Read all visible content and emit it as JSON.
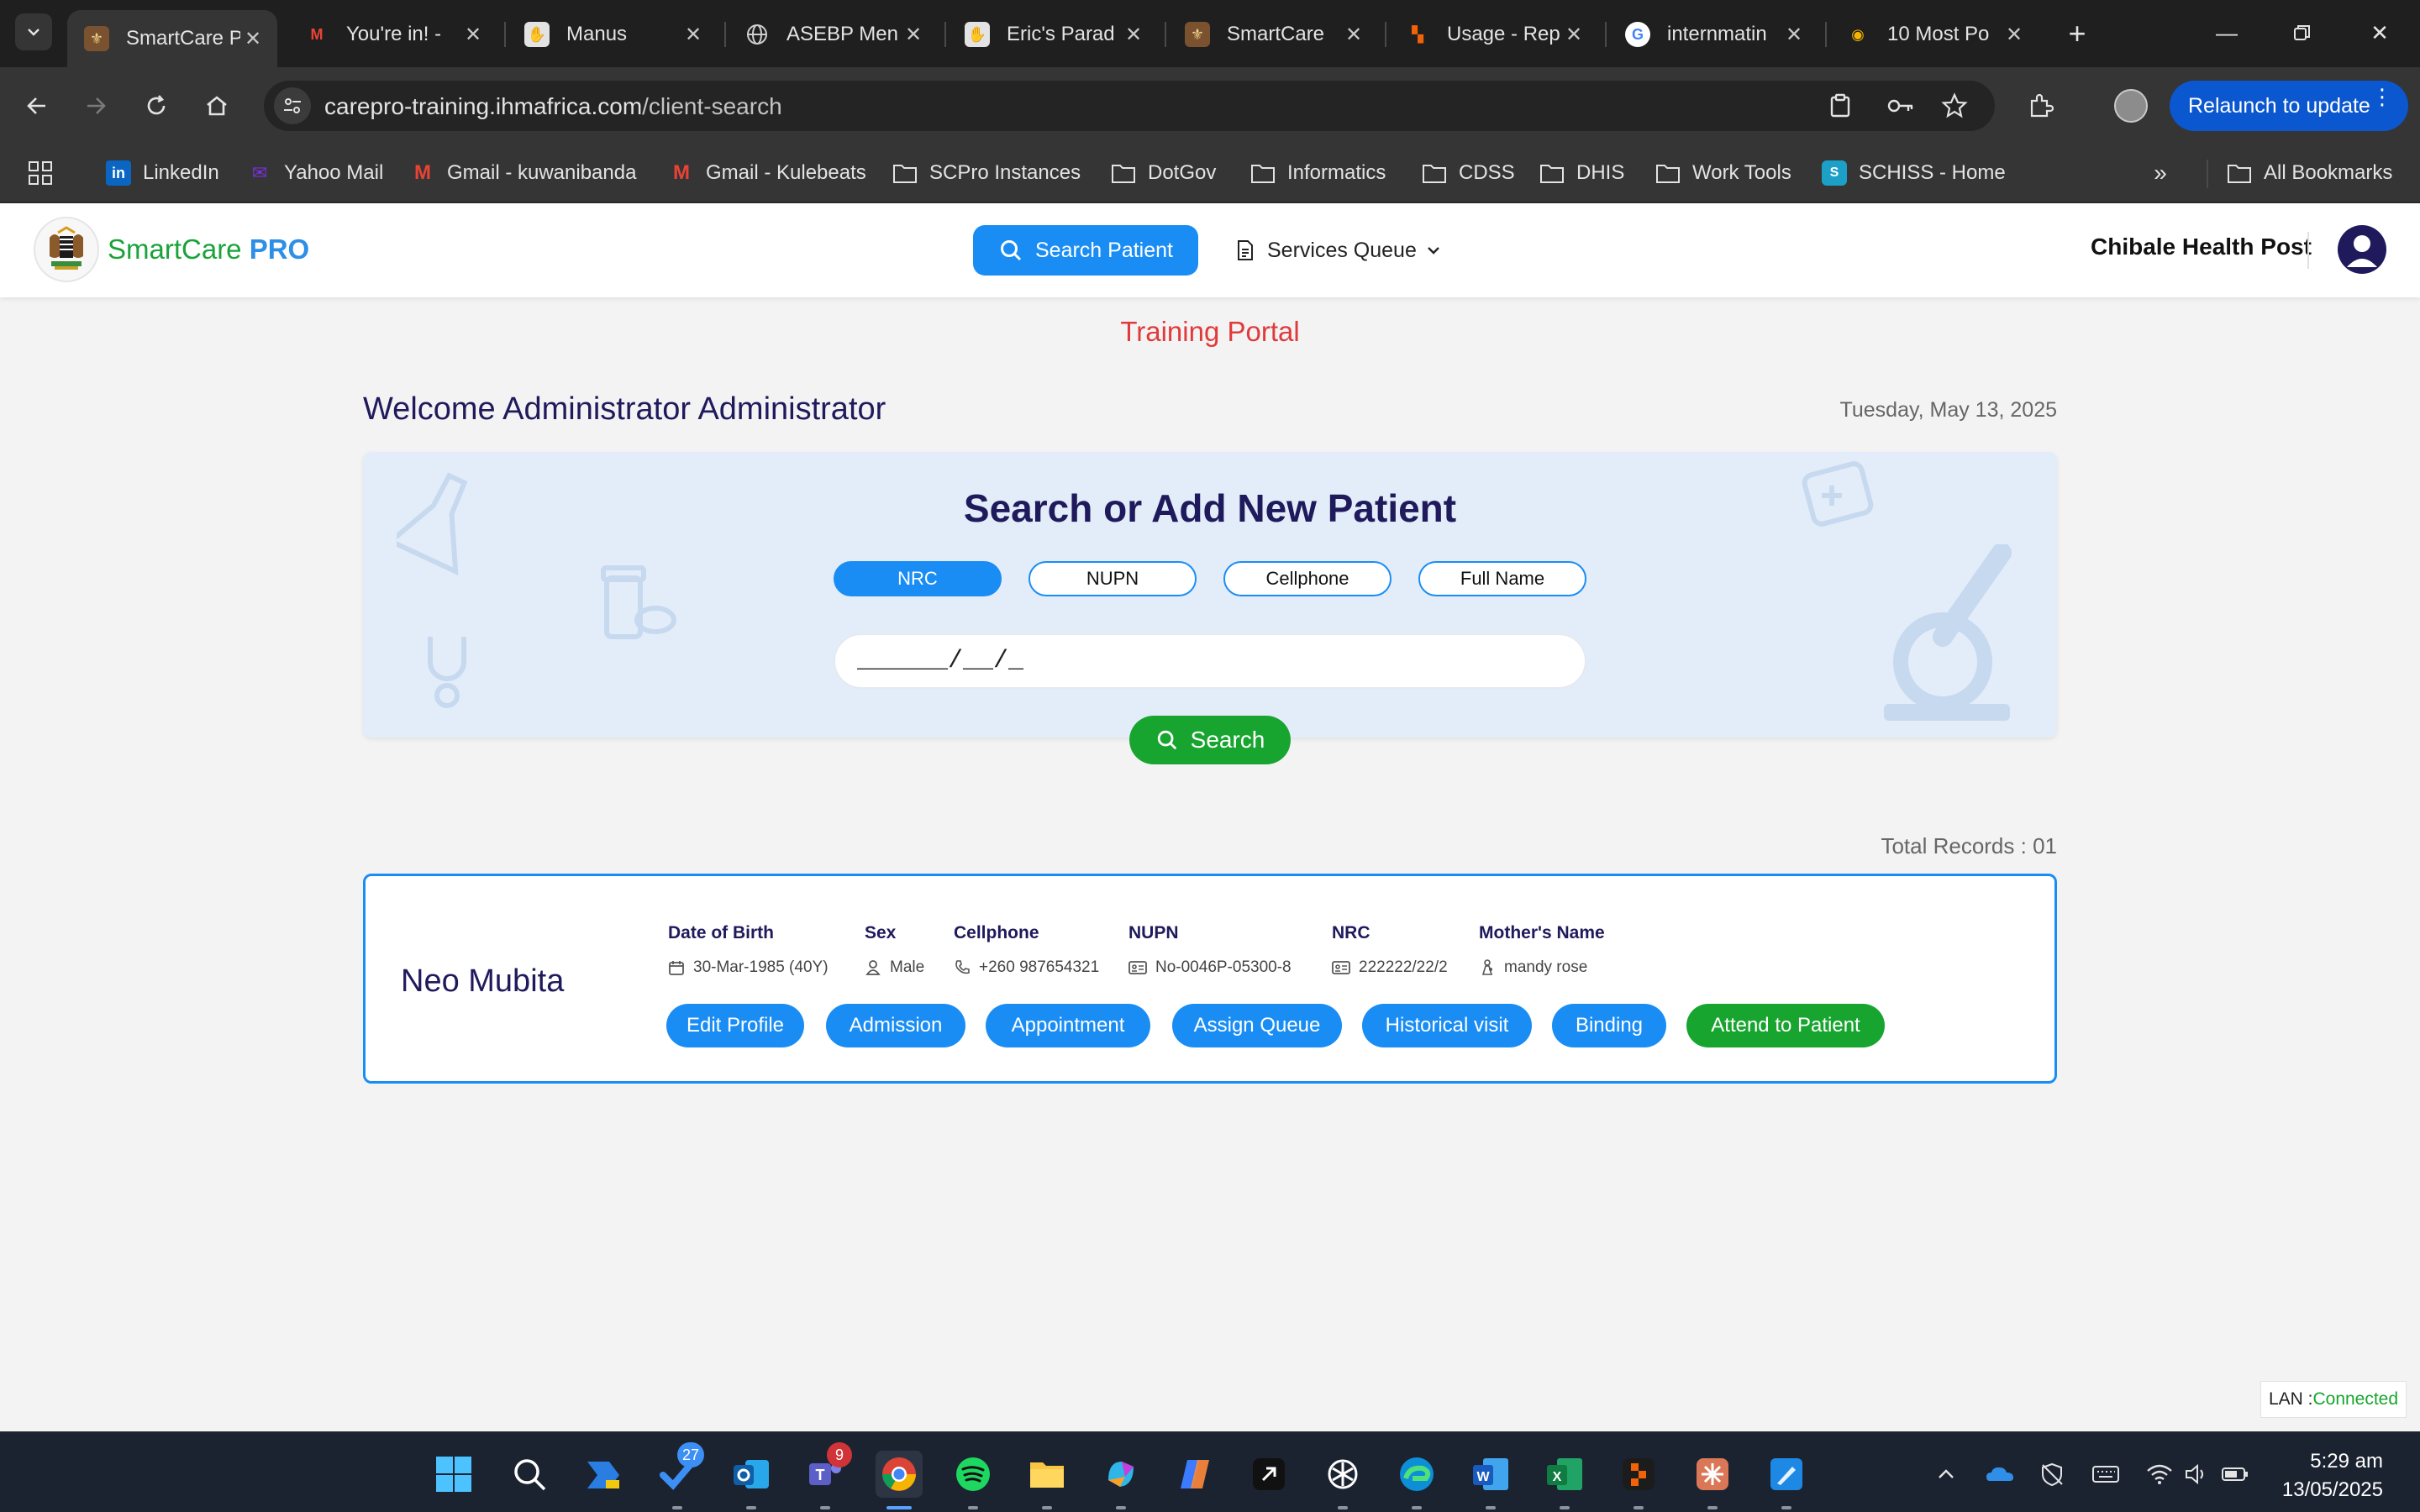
{
  "browser": {
    "tabs": [
      {
        "title": "SmartCare P",
        "icon": "smartcare-crest-icon"
      },
      {
        "title": "You're in! -",
        "icon": "gmail-icon"
      },
      {
        "title": "Manus",
        "icon": "manus-icon"
      },
      {
        "title": "ASEBP Men",
        "icon": "globe-icon"
      },
      {
        "title": "Eric's Parad",
        "icon": "manus-icon"
      },
      {
        "title": "SmartCare",
        "icon": "smartcare-crest-icon"
      },
      {
        "title": "Usage - Rep",
        "icon": "replit-icon"
      },
      {
        "title": "internmatin",
        "icon": "google-icon"
      },
      {
        "title": "10 Most Po",
        "icon": "maps-icon"
      }
    ],
    "url_host": "carepro-training.ihmafrica.com",
    "url_path": "/client-search",
    "relaunch_label": "Relaunch to update",
    "bookmarks": [
      {
        "label": "LinkedIn",
        "icon": "linkedin-icon"
      },
      {
        "label": "Yahoo Mail",
        "icon": "yahoo-icon"
      },
      {
        "label": "Gmail - kuwanibanda",
        "icon": "gmail-icon"
      },
      {
        "label": "Gmail - Kulebeats",
        "icon": "gmail-icon"
      },
      {
        "label": "SCPro Instances",
        "icon": "folder-icon"
      },
      {
        "label": "DotGov",
        "icon": "folder-icon"
      },
      {
        "label": "Informatics",
        "icon": "folder-icon"
      },
      {
        "label": "CDSS",
        "icon": "folder-icon"
      },
      {
        "label": "DHIS",
        "icon": "folder-icon"
      },
      {
        "label": "Work Tools",
        "icon": "folder-icon"
      },
      {
        "label": "SCHISS - Home",
        "icon": "schiss-icon"
      }
    ],
    "all_bookmarks_label": "All Bookmarks"
  },
  "app": {
    "brand_part1": "SmartCare",
    "brand_part2": "PRO",
    "nav_search_patient": "Search Patient",
    "nav_services_queue": "Services Queue",
    "facility": "Chibale Health Post",
    "banner": "Training Portal",
    "welcome": "Welcome Administrator Administrator",
    "date": "Tuesday, May 13, 2025",
    "colors": {
      "primary": "#1a8df5",
      "success": "#18a52f",
      "navy": "#1f1a5c",
      "danger": "#e03a3a"
    }
  },
  "search": {
    "title": "Search or Add New Patient",
    "filters": [
      "NRC",
      "NUPN",
      "Cellphone",
      "Full Name"
    ],
    "active_filter": "NRC",
    "input_value": "______/__/_",
    "button": "Search"
  },
  "results": {
    "total_label": "Total Records : 01",
    "patient": {
      "name": "Neo Mubita",
      "fields": [
        {
          "label": "Date of Birth",
          "value": "30-Mar-1985 (40Y)",
          "icon": "calendar-icon"
        },
        {
          "label": "Sex",
          "value": "Male",
          "icon": "person-icon"
        },
        {
          "label": "Cellphone",
          "value": "+260 987654321",
          "icon": "phone-icon"
        },
        {
          "label": "NUPN",
          "value": "No-0046P-05300-8",
          "icon": "id-card-icon"
        },
        {
          "label": "NRC",
          "value": "222222/22/2",
          "icon": "id-card-icon"
        },
        {
          "label": "Mother's Name",
          "value": "mandy rose",
          "icon": "mother-icon"
        }
      ],
      "actions": [
        "Edit Profile",
        "Admission",
        "Appointment",
        "Assign Queue",
        "Historical visit",
        "Binding",
        "Attend to Patient"
      ]
    }
  },
  "status": {
    "lan_label": "LAN : ",
    "lan_state": "Connected"
  },
  "taskbar": {
    "todo_badge": "27",
    "teams_badge": "9",
    "time": "5:29 am",
    "date": "13/05/2025"
  }
}
